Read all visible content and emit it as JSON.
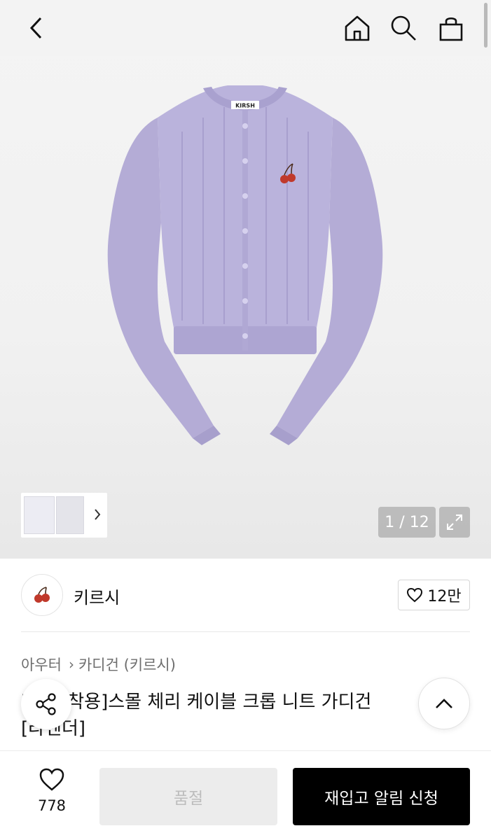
{
  "top_nav": {
    "back_icon": "chevron-left-icon",
    "home_icon": "home-icon",
    "search_icon": "search-icon",
    "bag_icon": "shopping-bag-icon"
  },
  "gallery": {
    "counter": "1 / 12",
    "brand_label": "KIRSH",
    "expand_icon": "expand-icon",
    "product_color": "#b7b0d8"
  },
  "brand": {
    "name": "키르시",
    "likes": "12만"
  },
  "product": {
    "breadcrumb": [
      "아우터",
      "카디건 (키르시)"
    ],
    "title_line1": "[박채 착용]스몰 체리 케이블 크롭 니트 가디건",
    "title_line2": "[라벤더]"
  },
  "bottom_bar": {
    "wish_count": "778",
    "soldout_label": "품절",
    "restock_label": "재입고 알림 신청"
  }
}
